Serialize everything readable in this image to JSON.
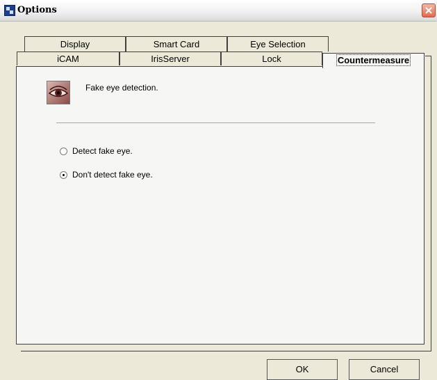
{
  "window": {
    "title": "Options",
    "close_label": "close"
  },
  "tabs": {
    "row1": [
      "Display",
      "Smart Card",
      "Eye Selection"
    ],
    "row2": [
      "iCAM",
      "IrisServer",
      "Lock",
      "Countermeasure"
    ],
    "active": "Countermeasure"
  },
  "panel": {
    "heading": "Fake eye detection.",
    "options": [
      {
        "label": "Detect fake eye.",
        "selected": false
      },
      {
        "label": "Don't detect fake eye.",
        "selected": true
      }
    ]
  },
  "buttons": {
    "ok": "OK",
    "cancel": "Cancel"
  },
  "colors": {
    "close_button": "#e46a4c",
    "panel_bg": "#f6f6f4"
  }
}
